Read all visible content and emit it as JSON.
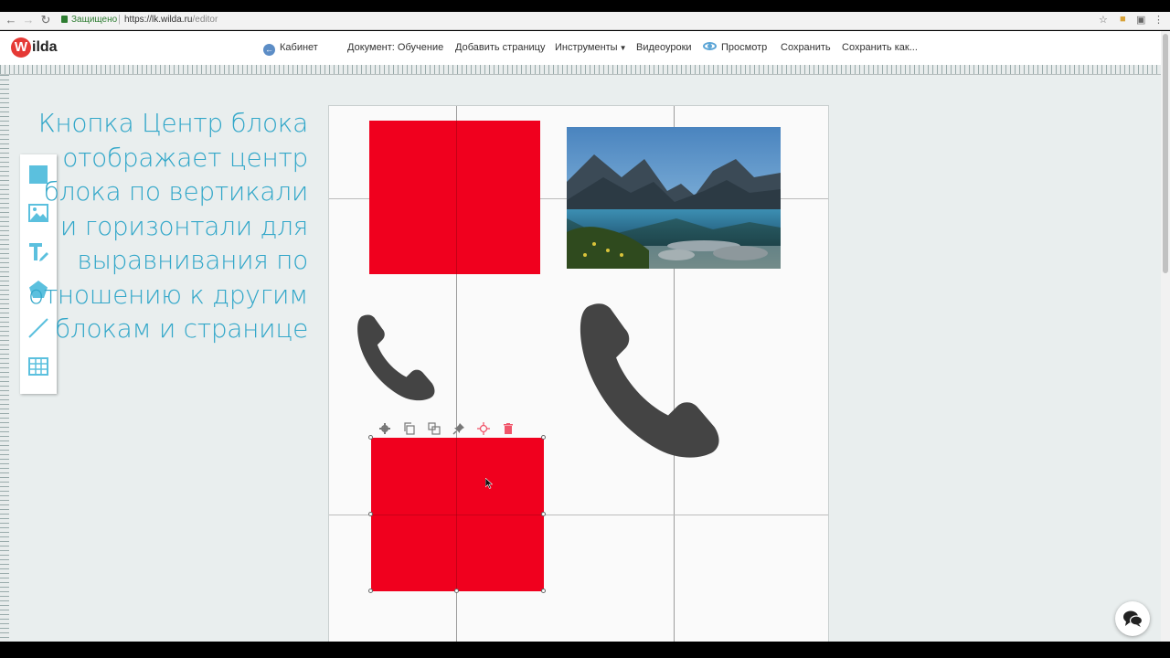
{
  "browser": {
    "secure_label": "Защищено",
    "url_host": "https://lk.wilda.ru",
    "url_path": "/editor"
  },
  "app": {
    "logo_letter": "W",
    "logo_text": "ilda",
    "menu": {
      "cabinet": "Кабинет",
      "document": "Документ: Обучение",
      "add_page": "Добавить страницу",
      "tools": "Инструменты",
      "video": "Видеоуроки",
      "preview": "Просмотр",
      "save": "Сохранить",
      "save_as": "Сохранить как..."
    }
  },
  "toolbox": {
    "items": [
      "square-tool-icon",
      "image-tool-icon",
      "text-tool-icon",
      "shape-tool-icon",
      "line-tool-icon",
      "table-tool-icon"
    ],
    "accent": "#5bc0de"
  },
  "hint": {
    "text": "Кнопка Центр блока отображает центр блока по вертикали и горизонтали для выравнивания по отношению к другим блокам и странице"
  },
  "canvas": {
    "block_color": "#f0001e",
    "icon_color": "#444444",
    "element_toolbar": [
      "gear-icon",
      "copy-icon",
      "duplicate-icon",
      "pin-icon",
      "center-block-icon",
      "delete-icon"
    ]
  },
  "colors": {
    "hint_text": "#32a7c9",
    "workspace_bg": "#e9eeee"
  }
}
